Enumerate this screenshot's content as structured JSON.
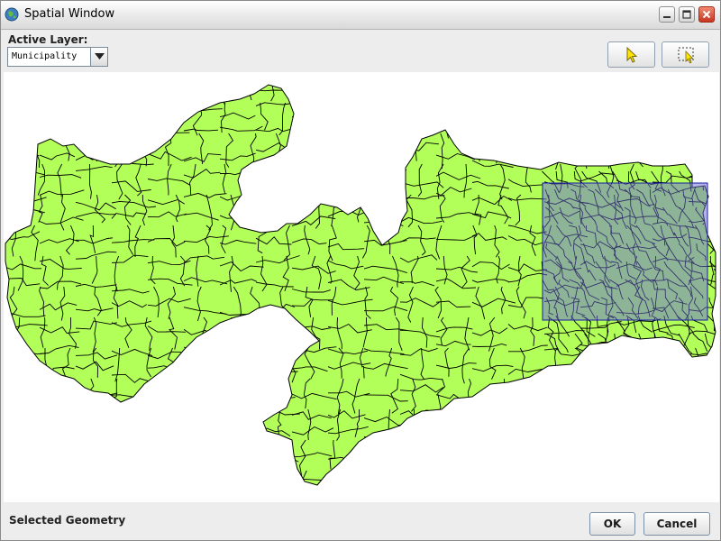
{
  "window": {
    "title": "Spatial Window"
  },
  "toolbar": {
    "active_layer_label": "Active Layer:",
    "layer_select_value": "Municipality",
    "pointer_tool_icon": "pointer-arrow-icon",
    "rect_select_tool_icon": "rectangle-select-icon"
  },
  "map": {
    "fill_color": "#b3ff59",
    "border_color": "#000000",
    "selection_fill_color": "#6a6ad8",
    "selection_border_color": "#1a1aa8"
  },
  "status": {
    "selected_label": "Selected Geometry"
  },
  "buttons": {
    "ok": "OK",
    "cancel": "Cancel"
  }
}
